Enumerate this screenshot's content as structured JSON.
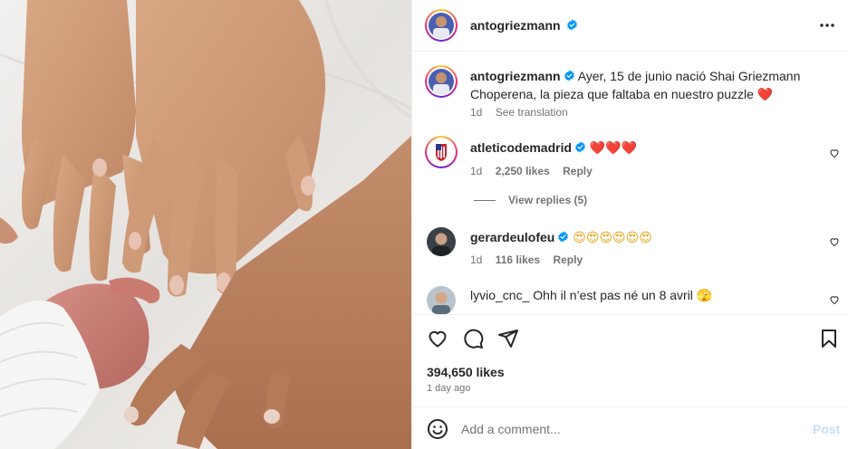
{
  "post": {
    "image_alt": "Hands of children placed together with a newborn's hand on white blanket",
    "author": "antogriezmann"
  },
  "caption": {
    "username": "antogriezmann",
    "text": "Ayer, 15 de junio nació Shai Griezmann Choperena, la pieza que faltaba en nuestro puzzle",
    "emoji": "❤️",
    "time": "1d",
    "translate": "See translation"
  },
  "comments": [
    {
      "username": "atleticodemadrid",
      "text": "❤️❤️❤️",
      "time": "1d",
      "likes": "2,250 likes",
      "reply": "Reply",
      "view_replies": "View replies (5)"
    },
    {
      "username": "gerardeulofeu",
      "text": "😍😍😍😍😍😍",
      "time": "1d",
      "likes": "116 likes",
      "reply": "Reply"
    },
    {
      "username": "lyvio_cnc_",
      "text": "Ohh il n’est pas né un 8 avril 🫣"
    }
  ],
  "stats": {
    "likes": "394,650 likes",
    "ago": "1 day ago"
  },
  "composer": {
    "placeholder": "Add a comment...",
    "post_label": "Post"
  },
  "icons": {
    "more": "more-horizontal-icon",
    "like": "heart-icon",
    "comment": "comment-bubble-icon",
    "share": "paper-plane-icon",
    "save": "bookmark-icon",
    "emoji": "smiley-icon",
    "verified": "verified-badge-icon"
  },
  "colors": {
    "verified": "#0095f6",
    "heart": "#ed4956",
    "muted": "#737373",
    "post_disabled": "#c5dff9"
  }
}
